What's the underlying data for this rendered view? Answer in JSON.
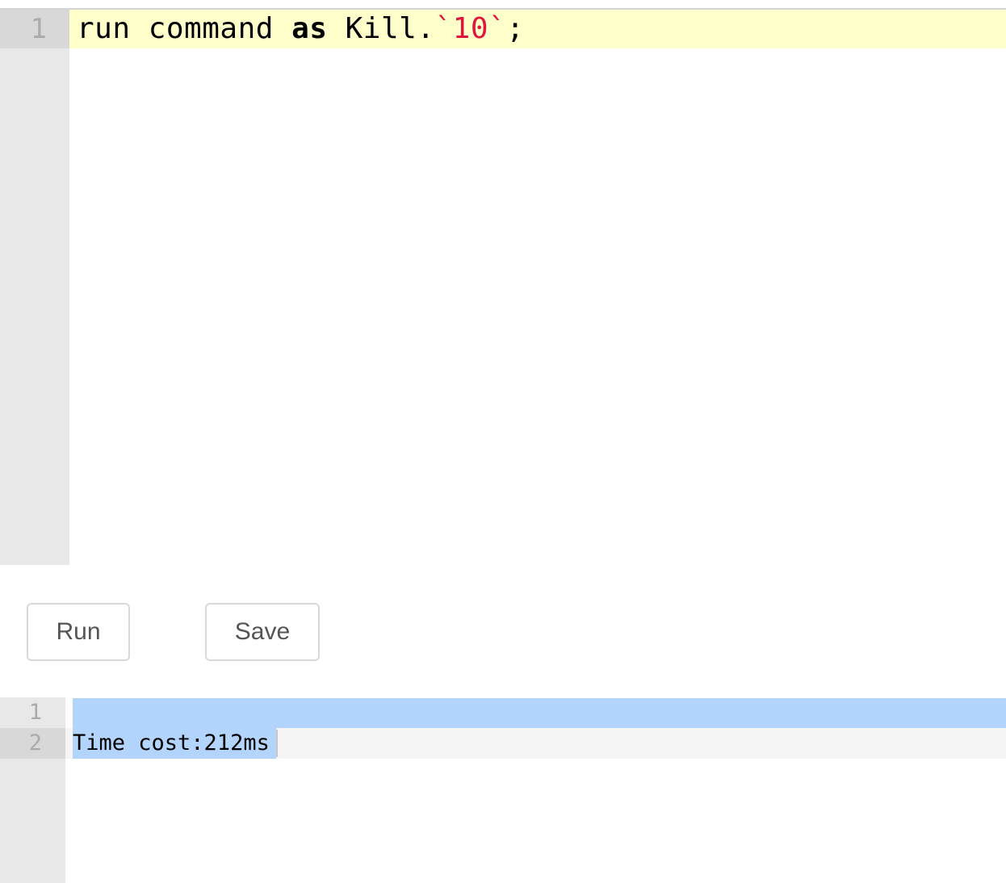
{
  "editor": {
    "line_numbers": [
      "1"
    ],
    "code_tokens": {
      "t1": "run command ",
      "t2": "as",
      "t3": " Kill.",
      "t4": "`10`",
      "t5": ";"
    }
  },
  "toolbar": {
    "run_label": "Run",
    "save_label": "Save"
  },
  "output": {
    "line_numbers": [
      "1",
      "2"
    ],
    "lines": [
      "",
      "Time cost:212ms"
    ]
  },
  "colors": {
    "active_line": "#ffffcc",
    "string_token": "#e0143c",
    "selection": "#b3d4fc",
    "gutter": "#e8e8e8"
  }
}
